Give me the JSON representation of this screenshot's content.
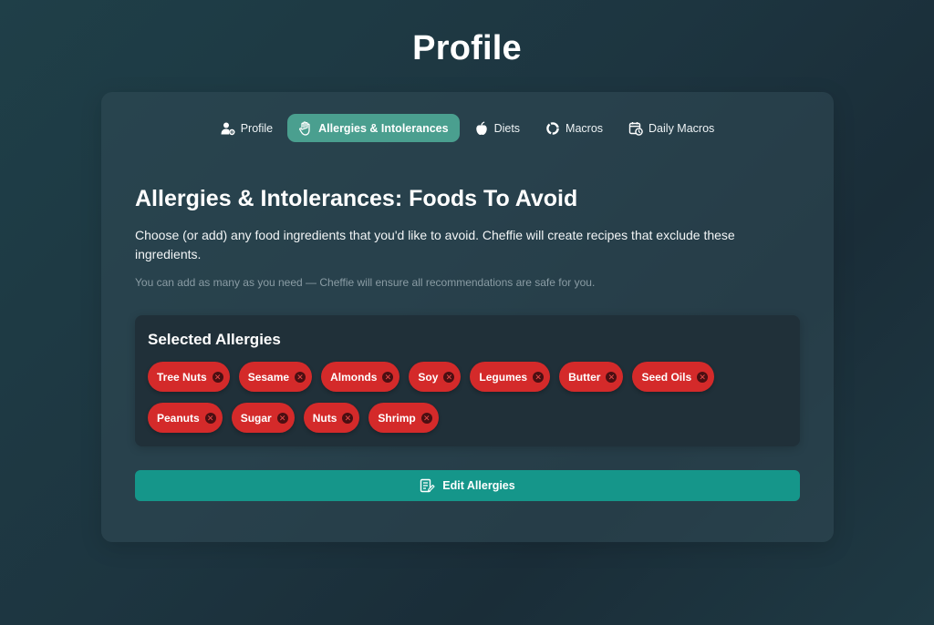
{
  "page": {
    "title": "Profile"
  },
  "tabs": [
    {
      "label": "Profile",
      "icon": "user-gear-icon",
      "active": false
    },
    {
      "label": "Allergies & Intolerances",
      "icon": "hand-icon",
      "active": true
    },
    {
      "label": "Diets",
      "icon": "apple-icon",
      "active": false
    },
    {
      "label": "Macros",
      "icon": "donut-chart-icon",
      "active": false
    },
    {
      "label": "Daily Macros",
      "icon": "calendar-clock-icon",
      "active": false
    }
  ],
  "section": {
    "heading": "Allergies & Intolerances: Foods To Avoid",
    "description": "Choose (or add) any food ingredients that you'd like to avoid. Cheffie will create recipes that exclude these ingredients.",
    "hint": "You can add as many as you need — Cheffie will ensure all recommendations are safe for you."
  },
  "selected": {
    "title": "Selected Allergies",
    "chips": [
      "Tree Nuts",
      "Sesame",
      "Almonds",
      "Soy",
      "Legumes",
      "Butter",
      "Seed Oils",
      "Peanuts",
      "Sugar",
      "Nuts",
      "Shrimp"
    ]
  },
  "actions": {
    "edit_label": "Edit Allergies",
    "edit_icon": "edit-list-icon"
  },
  "colors": {
    "accent_tab": "#4a9f8f",
    "button": "#15968a",
    "chip": "#d42a2a",
    "panel": "#203039"
  }
}
